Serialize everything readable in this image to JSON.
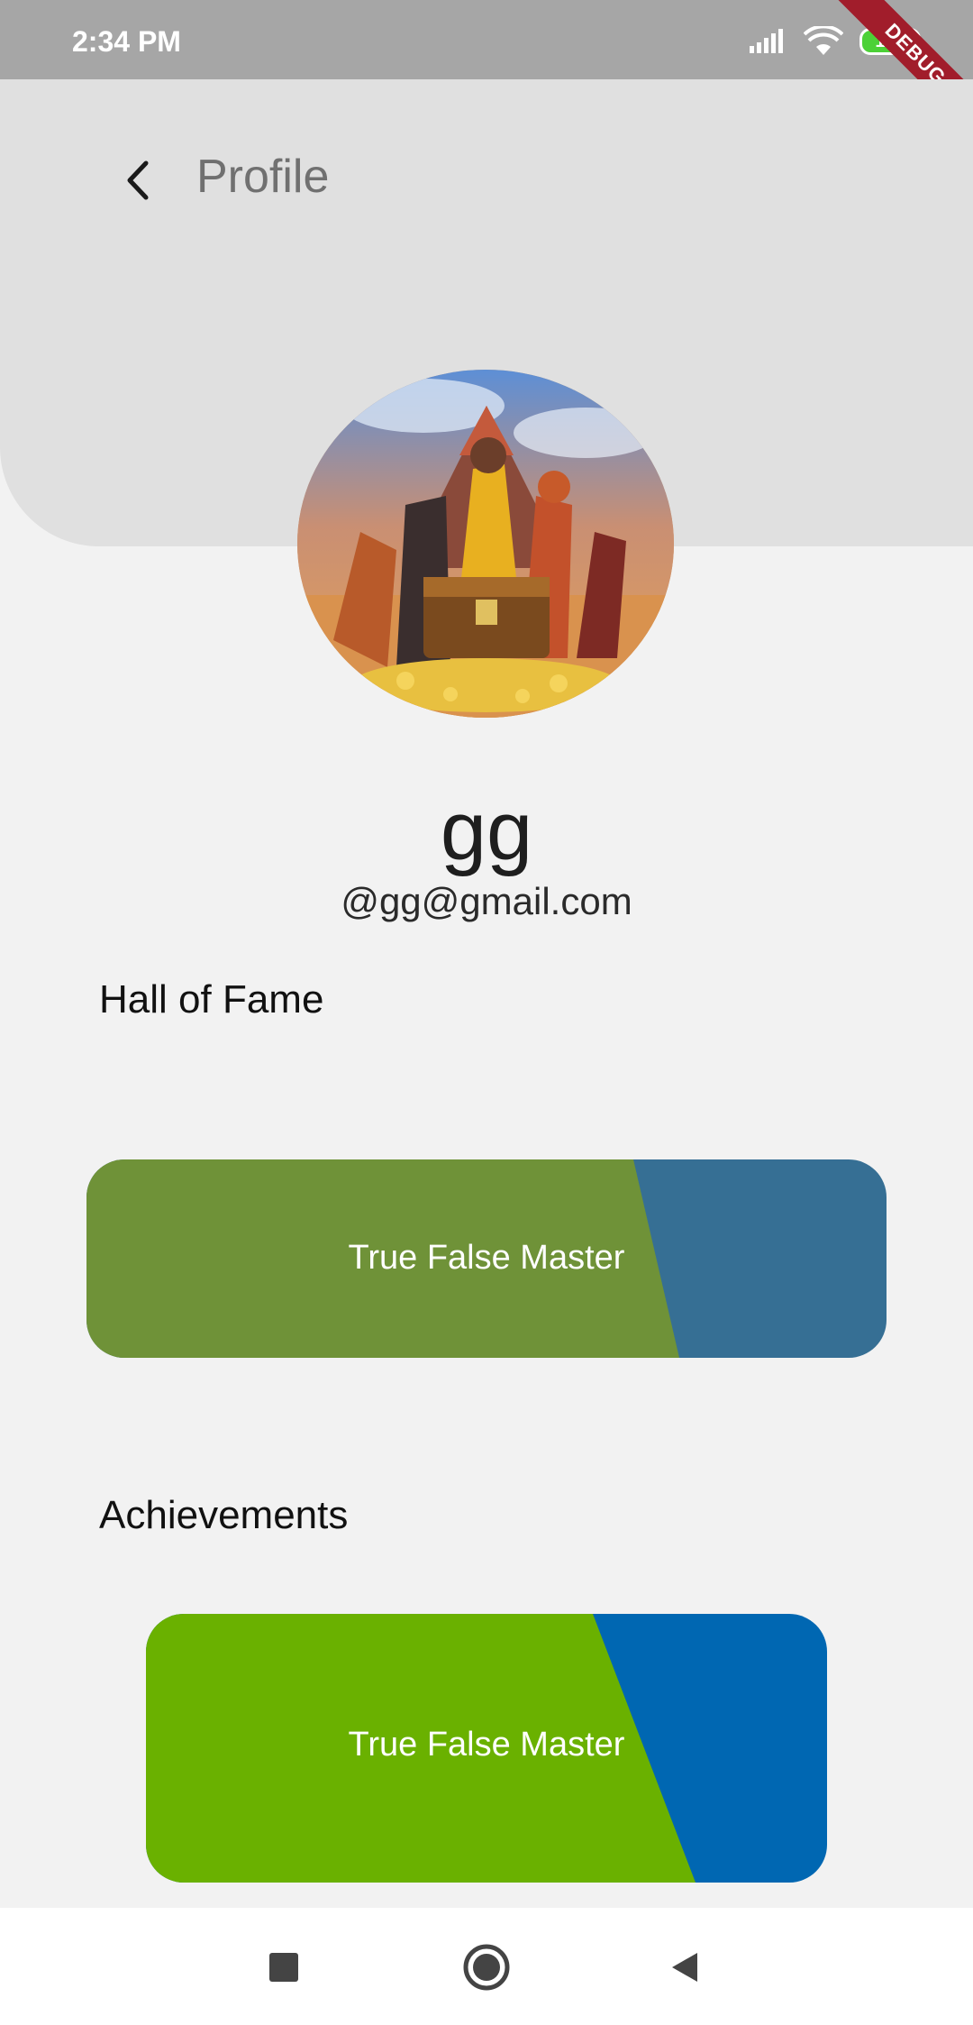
{
  "status_bar": {
    "time": "2:34 PM",
    "battery": "100",
    "debug_label": "DEBUG"
  },
  "header": {
    "title": "Profile",
    "back_icon": "chevron-left-icon"
  },
  "profile": {
    "name": "gg",
    "email": "@gg@gmail.com",
    "avatar": "game-artwork-avatar"
  },
  "hall_of_fame": {
    "title": "Hall of Fame",
    "card_label": "True False Master",
    "colors": {
      "primary": "#6f9238",
      "secondary": "#366f94"
    }
  },
  "achievements": {
    "title": "Achievements",
    "cards": [
      {
        "label": "True False Master",
        "colors": {
          "primary": "#6ab100",
          "secondary": "#0067b2"
        }
      }
    ],
    "next_card_color": "#2e8a6c"
  },
  "nav_bar": {
    "items": [
      "recents-square-icon",
      "home-circle-icon",
      "back-triangle-icon"
    ]
  }
}
